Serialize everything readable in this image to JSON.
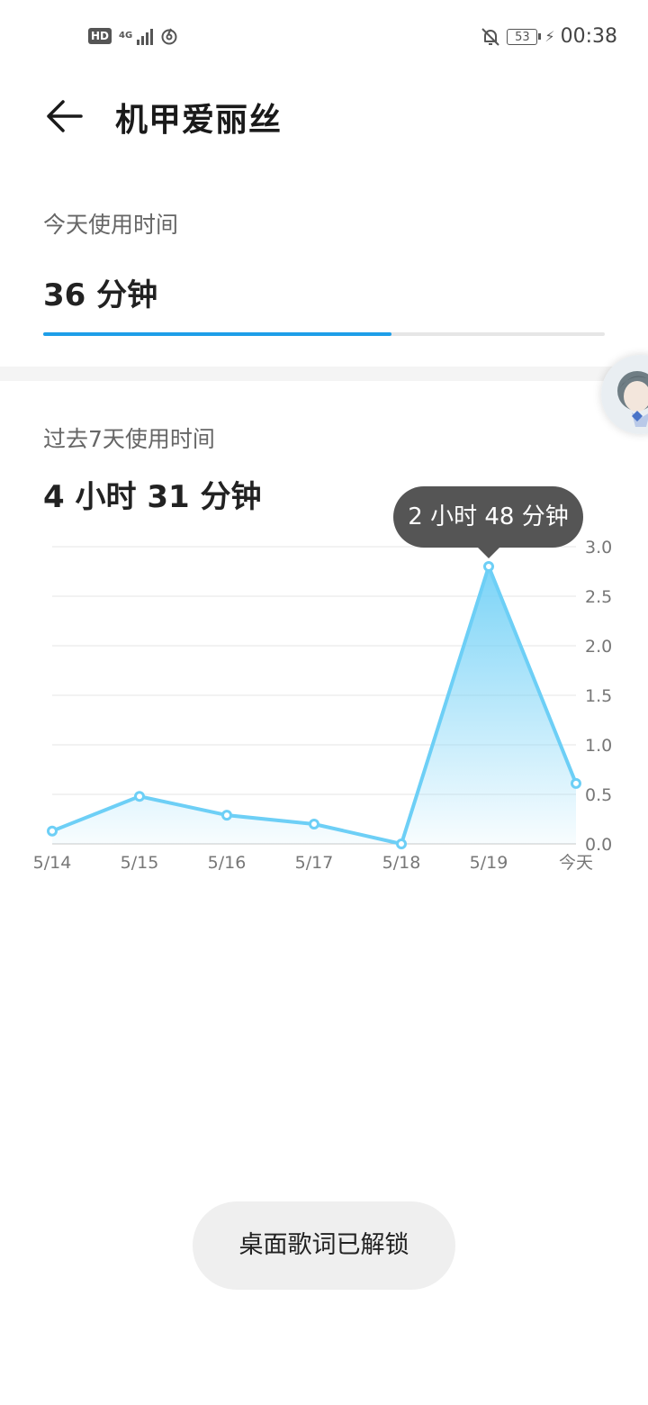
{
  "status_bar": {
    "hd_badge": "HD",
    "network_type": "4G",
    "battery_level": "53",
    "time": "00:38",
    "icons": [
      "hd-icon",
      "signal-icon",
      "netease-music-icon",
      "bell-off-icon",
      "battery-icon",
      "charging-icon"
    ]
  },
  "header": {
    "title": "机甲爱丽丝",
    "back_icon": "arrow-left-icon"
  },
  "today": {
    "label": "今天使用时间",
    "value": "36 分钟",
    "progress_fraction": 0.62,
    "accent_color": "#1d9ee8"
  },
  "week": {
    "label": "过去7天使用时间",
    "value": "4 小时 31 分钟",
    "tooltip": "2 小时 48 分钟"
  },
  "chart_data": {
    "type": "area",
    "categories": [
      "5/14",
      "5/15",
      "5/16",
      "5/17",
      "5/18",
      "5/19",
      "今天"
    ],
    "values": [
      0.13,
      0.48,
      0.29,
      0.2,
      0.0,
      2.8,
      0.61
    ],
    "y_ticks": [
      "0.0",
      "0.5",
      "1.0",
      "1.5",
      "2.0",
      "2.5",
      "3.0"
    ],
    "ylim": [
      0,
      3.0
    ],
    "y_axis_side": "right",
    "grid": true,
    "line_color": "#6dcff6",
    "highlight_index": 5
  },
  "toast": {
    "text": "桌面歌词已解锁"
  }
}
